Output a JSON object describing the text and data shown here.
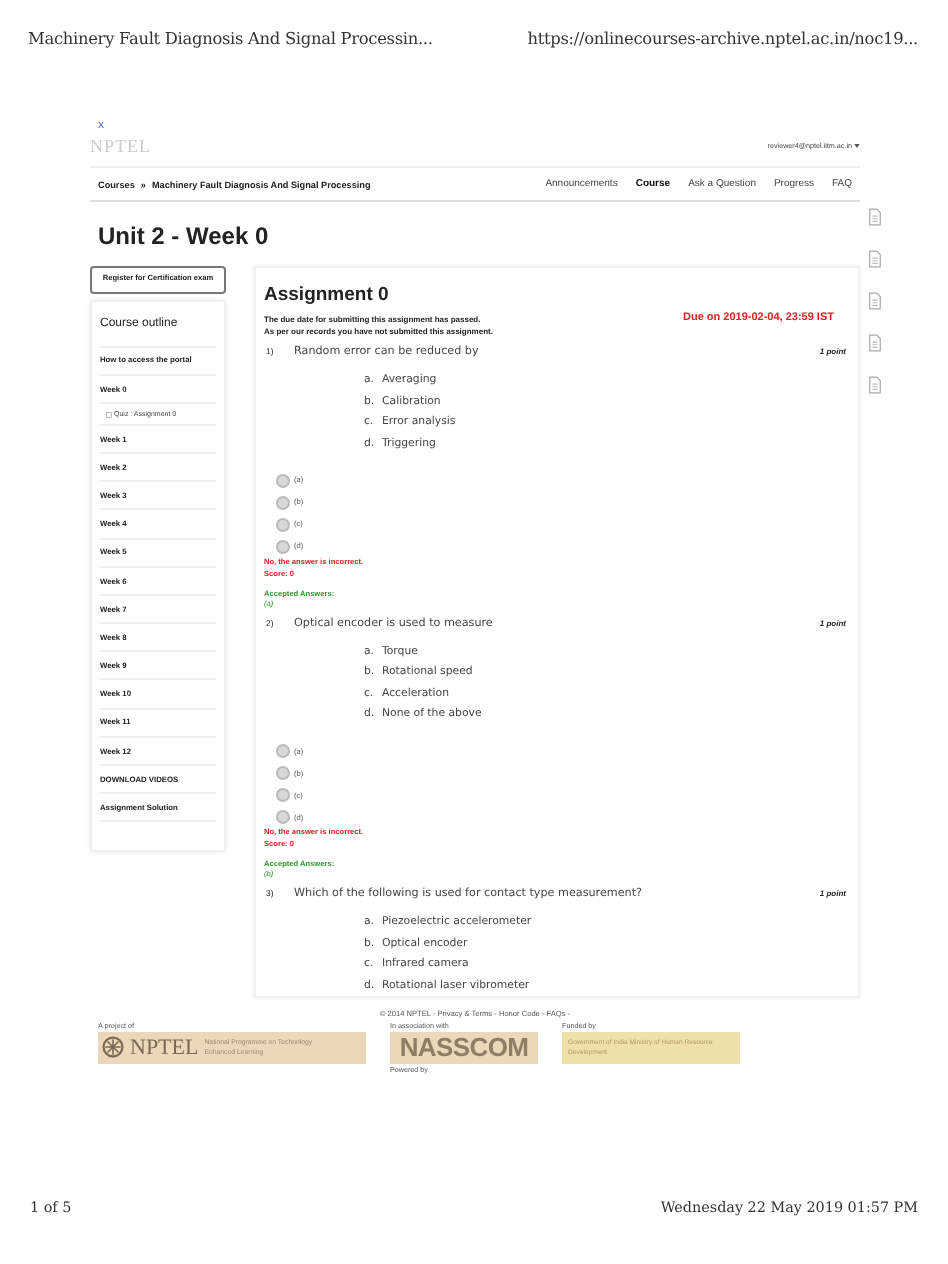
{
  "print_header": {
    "title": "Machinery Fault Diagnosis And Signal Processin...",
    "url": "https://onlinecourses-archive.nptel.ac.in/noc19..."
  },
  "close_link": "x",
  "logo": "NPTEL",
  "user_email": "reviewer4@nptel.iitm.ac.in",
  "breadcrumb": {
    "root": "Courses",
    "separator": "»",
    "course": "Machinery Fault Diagnosis And Signal Processing"
  },
  "nav": [
    {
      "label": "Announcements",
      "selected": false
    },
    {
      "label": "Course",
      "selected": true
    },
    {
      "label": "Ask a Question",
      "selected": false
    },
    {
      "label": "Progress",
      "selected": false
    },
    {
      "label": "FAQ",
      "selected": false
    }
  ],
  "page_title": "Unit 2 - Week 0",
  "sidebar": {
    "register_button": "Register for Certification exam",
    "outline_title": "Course outline",
    "items": [
      {
        "label": "How to access the portal",
        "kind": "item"
      },
      {
        "label": "Week 0",
        "kind": "item"
      },
      {
        "label": "Quiz : Assignment 0",
        "kind": "sub"
      },
      {
        "label": "Week 1",
        "kind": "item"
      },
      {
        "label": "Week 2",
        "kind": "item"
      },
      {
        "label": "Week 3",
        "kind": "item"
      },
      {
        "label": "Week 4",
        "kind": "item"
      },
      {
        "label": "Week 5",
        "kind": "item"
      },
      {
        "label": "Week 6",
        "kind": "item"
      },
      {
        "label": "Week 7",
        "kind": "item"
      },
      {
        "label": "Week 8",
        "kind": "item"
      },
      {
        "label": "Week 9",
        "kind": "item"
      },
      {
        "label": "Week 10",
        "kind": "item"
      },
      {
        "label": "Week 11",
        "kind": "item"
      },
      {
        "label": "Week 12",
        "kind": "item"
      },
      {
        "label": "DOWNLOAD VIDEOS",
        "kind": "item"
      },
      {
        "label": "Assignment Solution",
        "kind": "item"
      }
    ]
  },
  "assignment": {
    "title": "Assignment 0",
    "notice": [
      "The due date for submitting this assignment has passed.",
      "As per our records you have not submitted this assignment."
    ],
    "due": "Due on 2019-02-04, 23:59 IST",
    "questions": [
      {
        "number": "1)",
        "text": "Random error can be reduced by",
        "points": "1 point",
        "options": [
          {
            "letter": "a.",
            "text": "Averaging"
          },
          {
            "letter": "b.",
            "text": "Calibration"
          },
          {
            "letter": "c.",
            "text": "Error analysis"
          },
          {
            "letter": "d.",
            "text": "Triggering"
          }
        ],
        "radios": [
          {
            "label": "(a)",
            "selected": false
          },
          {
            "label": "(b)",
            "selected": false
          },
          {
            "label": "(c)",
            "selected": false
          },
          {
            "label": "(d)",
            "selected": false
          }
        ],
        "result": "No, the answer is incorrect.",
        "score": "Score: 0",
        "accepted_label": "Accepted Answers:",
        "accepted": "(a)"
      },
      {
        "number": "2)",
        "text": "Optical encoder is used to measure",
        "points": "1 point",
        "options": [
          {
            "letter": "a.",
            "text": "Torque"
          },
          {
            "letter": "b.",
            "text": "Rotational speed"
          },
          {
            "letter": "c.",
            "text": "Acceleration"
          },
          {
            "letter": "d.",
            "text": "None of the above"
          }
        ],
        "radios": [
          {
            "label": "(a)",
            "selected": false
          },
          {
            "label": "(b)",
            "selected": false
          },
          {
            "label": "(c)",
            "selected": false
          },
          {
            "label": "(d)",
            "selected": false
          }
        ],
        "result": "No, the answer is incorrect.",
        "score": "Score: 0",
        "accepted_label": "Accepted Answers:",
        "accepted": "(b)"
      },
      {
        "number": "3)",
        "text": "Which of the following is used for contact type measurement?",
        "points": "1 point",
        "options": [
          {
            "letter": "a.",
            "text": "Piezoelectric accelerometer"
          },
          {
            "letter": "b.",
            "text": "Optical encoder"
          },
          {
            "letter": "c.",
            "text": "Infrared camera"
          },
          {
            "letter": "d.",
            "text": "Rotational laser vibrometer"
          }
        ]
      }
    ]
  },
  "footer": {
    "copyright": "© 2014 NPTEL - Privacy & Terms - Honor Code - FAQs -",
    "project_label": "A project of",
    "project_logo": "NPTEL",
    "project_tagline": "National Programme on Technology Enhanced Learning",
    "association_label": "In association with",
    "association_logo": "NASSCOM",
    "funded_label": "Funded by",
    "funded_text": "Government of India Ministry of Human Resource Development",
    "powered_label": "Powered by"
  },
  "print_footer": {
    "page": "1 of 5",
    "date": "Wednesday 22 May 2019 01:57 PM"
  }
}
